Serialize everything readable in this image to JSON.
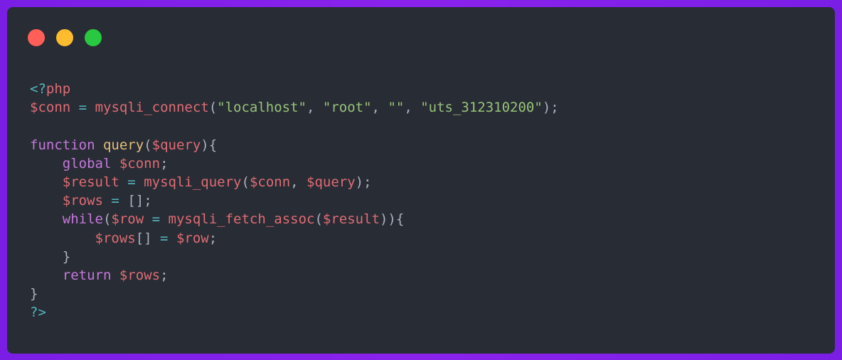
{
  "window": {
    "buttons": [
      "close",
      "minimize",
      "maximize"
    ],
    "colors": {
      "close": "#ff5f57",
      "minimize": "#febc2e",
      "maximize": "#28c840",
      "background": "#282c34",
      "frame": "#7c1fe6"
    }
  },
  "code": {
    "language": "php",
    "lines": [
      [
        {
          "t": "tag",
          "v": "<?"
        },
        {
          "t": "php",
          "v": "php"
        }
      ],
      [
        {
          "t": "var",
          "v": "$conn"
        },
        {
          "t": "punc",
          "v": " "
        },
        {
          "t": "op",
          "v": "="
        },
        {
          "t": "punc",
          "v": " "
        },
        {
          "t": "fn",
          "v": "mysqli_connect"
        },
        {
          "t": "punc",
          "v": "("
        },
        {
          "t": "str",
          "v": "\"localhost\""
        },
        {
          "t": "punc",
          "v": ", "
        },
        {
          "t": "str",
          "v": "\"root\""
        },
        {
          "t": "punc",
          "v": ", "
        },
        {
          "t": "str",
          "v": "\"\""
        },
        {
          "t": "punc",
          "v": ", "
        },
        {
          "t": "str",
          "v": "\"uts_312310200\""
        },
        {
          "t": "punc",
          "v": ");"
        }
      ],
      [],
      [
        {
          "t": "kw",
          "v": "function"
        },
        {
          "t": "punc",
          "v": " "
        },
        {
          "t": "def",
          "v": "query"
        },
        {
          "t": "punc",
          "v": "("
        },
        {
          "t": "var",
          "v": "$query"
        },
        {
          "t": "punc",
          "v": "){"
        }
      ],
      [
        {
          "t": "punc",
          "v": "    "
        },
        {
          "t": "kw",
          "v": "global"
        },
        {
          "t": "punc",
          "v": " "
        },
        {
          "t": "var",
          "v": "$conn"
        },
        {
          "t": "punc",
          "v": ";"
        }
      ],
      [
        {
          "t": "punc",
          "v": "    "
        },
        {
          "t": "var",
          "v": "$result"
        },
        {
          "t": "punc",
          "v": " "
        },
        {
          "t": "op",
          "v": "="
        },
        {
          "t": "punc",
          "v": " "
        },
        {
          "t": "fn",
          "v": "mysqli_query"
        },
        {
          "t": "punc",
          "v": "("
        },
        {
          "t": "var",
          "v": "$conn"
        },
        {
          "t": "punc",
          "v": ", "
        },
        {
          "t": "var",
          "v": "$query"
        },
        {
          "t": "punc",
          "v": ");"
        }
      ],
      [
        {
          "t": "punc",
          "v": "    "
        },
        {
          "t": "var",
          "v": "$rows"
        },
        {
          "t": "punc",
          "v": " "
        },
        {
          "t": "op",
          "v": "="
        },
        {
          "t": "punc",
          "v": " [];"
        }
      ],
      [
        {
          "t": "punc",
          "v": "    "
        },
        {
          "t": "kw",
          "v": "while"
        },
        {
          "t": "punc",
          "v": "("
        },
        {
          "t": "var",
          "v": "$row"
        },
        {
          "t": "punc",
          "v": " "
        },
        {
          "t": "op",
          "v": "="
        },
        {
          "t": "punc",
          "v": " "
        },
        {
          "t": "fn",
          "v": "mysqli_fetch_assoc"
        },
        {
          "t": "punc",
          "v": "("
        },
        {
          "t": "var",
          "v": "$result"
        },
        {
          "t": "punc",
          "v": ")){"
        }
      ],
      [
        {
          "t": "punc",
          "v": "        "
        },
        {
          "t": "var",
          "v": "$rows"
        },
        {
          "t": "punc",
          "v": "[] "
        },
        {
          "t": "op",
          "v": "="
        },
        {
          "t": "punc",
          "v": " "
        },
        {
          "t": "var",
          "v": "$row"
        },
        {
          "t": "punc",
          "v": ";"
        }
      ],
      [
        {
          "t": "punc",
          "v": "    }"
        }
      ],
      [
        {
          "t": "punc",
          "v": "    "
        },
        {
          "t": "kw",
          "v": "return"
        },
        {
          "t": "punc",
          "v": " "
        },
        {
          "t": "var",
          "v": "$rows"
        },
        {
          "t": "punc",
          "v": ";"
        }
      ],
      [
        {
          "t": "punc",
          "v": "}"
        }
      ],
      [
        {
          "t": "tag",
          "v": "?>"
        }
      ]
    ]
  }
}
